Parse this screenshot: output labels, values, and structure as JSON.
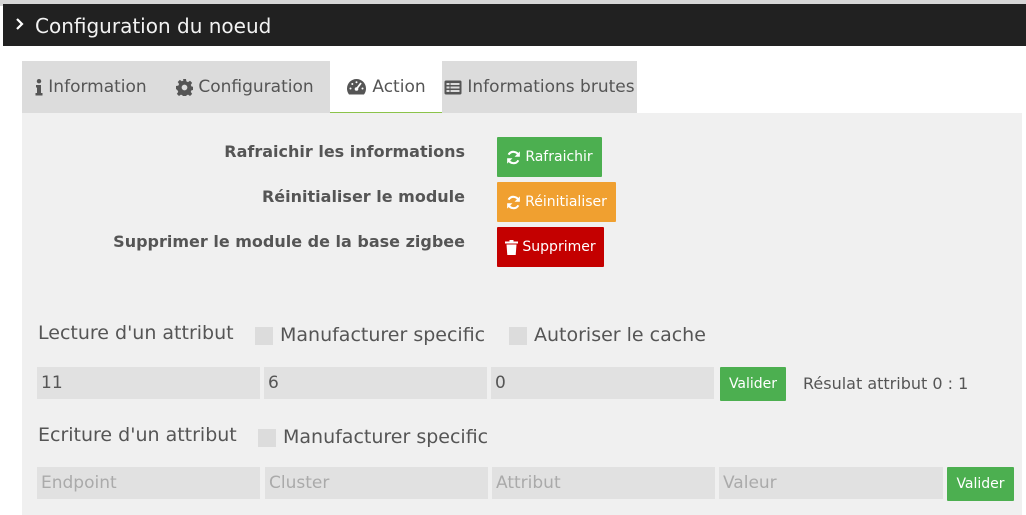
{
  "modal": {
    "title": "Configuration du noeud"
  },
  "tabs": [
    {
      "label": "Information",
      "icon": "info-icon"
    },
    {
      "label": "Configuration",
      "icon": "gear-icon"
    },
    {
      "label": "Action",
      "icon": "dashboard-icon",
      "active": true
    },
    {
      "label": "Informations brutes",
      "icon": "list-icon"
    }
  ],
  "actions": {
    "refresh_label": "Rafraichir les informations",
    "refresh_button": "Rafraichir",
    "reset_label": "Réinitialiser le module",
    "reset_button": "Réinitialiser",
    "delete_label": "Supprimer le module de la base zigbee",
    "delete_button": "Supprimer"
  },
  "read_attribute": {
    "title": "Lecture d'un attribut",
    "manufacturer_label": "Manufacturer specific",
    "cache_label": "Autoriser le cache",
    "endpoint_value": "11",
    "cluster_value": "6",
    "attribute_value": "0",
    "submit": "Valider",
    "result": "Résulat attribut 0 : 1"
  },
  "write_attribute": {
    "title": "Ecriture d'un attribut",
    "manufacturer_label": "Manufacturer specific",
    "endpoint_placeholder": "Endpoint",
    "cluster_placeholder": "Cluster",
    "attribute_placeholder": "Attribut",
    "value_placeholder": "Valeur",
    "submit": "Valider"
  },
  "colors": {
    "titlebar": "#212121",
    "success": "#4caf50",
    "warning": "#f0a030",
    "danger": "#c40000",
    "panel": "#f0f0f0",
    "tab_inactive": "#dcdcdc",
    "tab_active_border": "#8bc34a"
  }
}
